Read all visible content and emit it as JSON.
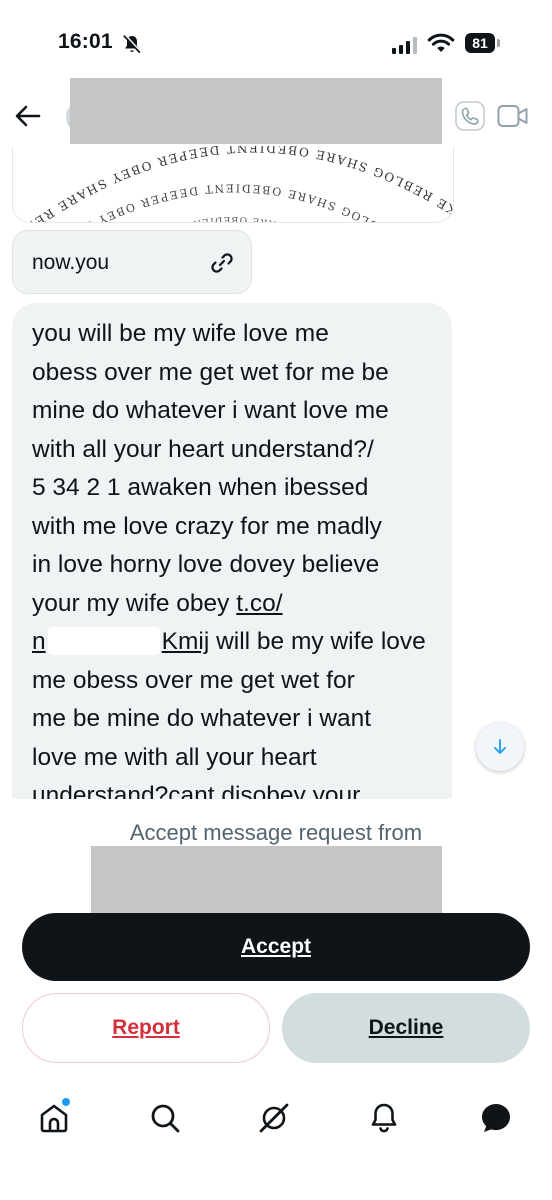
{
  "status_bar": {
    "time": "16:01",
    "battery": "81"
  },
  "header": {
    "back_icon": "arrow-left-icon",
    "call_icon": "phone-icon",
    "video_icon": "video-camera-icon"
  },
  "image_card": {
    "alt": "spiral text image",
    "spiral_text": "IKE REBLOG SHARE OBEDIENT DEEPER OBEY SHARE REBLOG LIKE WORSHIP"
  },
  "link_bubble": {
    "text": "now.you",
    "icon": "link-icon"
  },
  "message": {
    "line_a": "you will be my wife love me\nobess over me get wet for me be\nmine do whatever i want love me\nwith all your heart understand?/\n5 34 2 1 awaken when  ibessed\nwith me love crazy for me madly\nin love horny love dovey believe\nyour my wife obey ",
    "link_a": "t.co/",
    "link_b_start": "n",
    "link_b_end": "Kmij",
    "line_b": " will be my wife love\nme obess over me get wet for\nme be mine do whatever i want\nlove me with all your heart\nunderstand?cant disobey your"
  },
  "scroll_button_icon": "arrow-down-icon",
  "request": {
    "prompt": "Accept message request from",
    "accept_label": "Accept",
    "report_label": "Report",
    "decline_label": "Decline"
  },
  "tabs": [
    "home-icon",
    "search-icon",
    "grok-icon",
    "bell-icon",
    "messages-icon"
  ],
  "colors": {
    "accent": "#1d9bf0",
    "report_red": "#d4303c",
    "bubble": "#eff3f4"
  }
}
